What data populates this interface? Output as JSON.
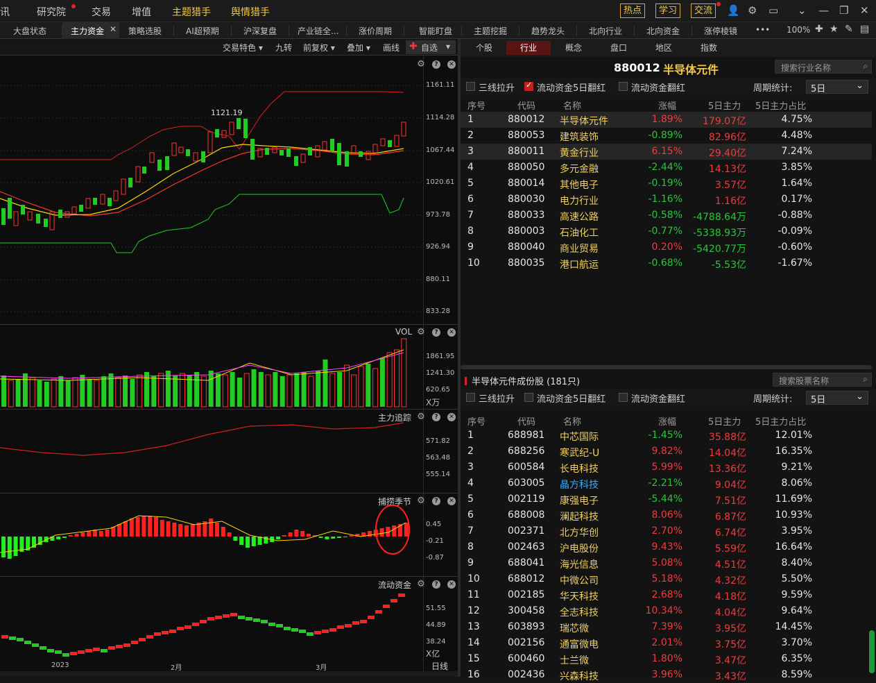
{
  "menu": {
    "items": [
      "讯",
      "研究院",
      "交易",
      "增值",
      "主题猎手",
      "舆情猎手"
    ],
    "right_buttons": [
      "热点",
      "学习",
      "交流"
    ],
    "zoom": "100%"
  },
  "tabs": [
    "大盘状态",
    "主力资金",
    "策略选股",
    "AI超预期",
    "沪深复盘",
    "产业链全...",
    "涨价周期",
    "智能盯盘",
    "主题挖掘",
    "趋势龙头",
    "北向行业",
    "北向资金",
    "涨停棱镜"
  ],
  "toolbar": [
    "交易特色",
    "九转",
    "前复权",
    "叠加",
    "画线",
    "自选"
  ],
  "chart": {
    "main_y": [
      "1161.11",
      "1114.28",
      "1067.44",
      "1020.61",
      "973.78",
      "926.94",
      "880.11",
      "833.28"
    ],
    "high_label": "1121.19",
    "vol_title": "VOL",
    "vol_y": [
      "1861.95",
      "1241.30",
      "620.65"
    ],
    "vol_unit": "X万",
    "p3_title": "主力追踪",
    "p3_y": [
      "571.82",
      "563.48",
      "555.14"
    ],
    "p4_title": "捕捞季节",
    "p4_y": [
      "0.45",
      "-0.21",
      "-0.87"
    ],
    "p5_title": "流动资金",
    "p5_y": [
      "51.55",
      "44.89",
      "38.24"
    ],
    "p5_unit": "X亿",
    "x_labels": [
      "2023",
      "2月",
      "3月"
    ],
    "period": "日线"
  },
  "right": {
    "tabs": [
      "个股",
      "行业",
      "概念",
      "盘口",
      "地区",
      "指数"
    ],
    "title_code": "880012",
    "title_name": "半导体元件",
    "search1": "搜索行业名称",
    "search2": "搜索股票名称",
    "checks": [
      "三线拉升",
      "流动资金5日翻红",
      "流动资金翻红"
    ],
    "period_label": "周期统计:",
    "period_value": "5日",
    "headers": [
      "序号",
      "代码",
      "名称",
      "涨幅",
      "5日主力",
      "5日主力占比"
    ],
    "industry_rows": [
      [
        "1",
        "880012",
        "半导体元件",
        "1.89%",
        "179.07亿",
        "4.75%"
      ],
      [
        "2",
        "880053",
        "建筑装饰",
        "-0.89%",
        "82.96亿",
        "4.48%"
      ],
      [
        "3",
        "880011",
        "黄金行业",
        "6.15%",
        "29.40亿",
        "7.24%"
      ],
      [
        "4",
        "880050",
        "多元金融",
        "-2.44%",
        "14.13亿",
        "3.85%"
      ],
      [
        "5",
        "880014",
        "其他电子",
        "-0.19%",
        "3.57亿",
        "1.64%"
      ],
      [
        "6",
        "880030",
        "电力行业",
        "-1.16%",
        "1.16亿",
        "0.17%"
      ],
      [
        "7",
        "880033",
        "高速公路",
        "-0.58%",
        "-4788.64万",
        "-0.88%"
      ],
      [
        "8",
        "880003",
        "石油化工",
        "-0.77%",
        "-5338.93万",
        "-0.09%"
      ],
      [
        "9",
        "880040",
        "商业贸易",
        "0.20%",
        "-5420.77万",
        "-0.60%"
      ],
      [
        "10",
        "880035",
        "港口航运",
        "-0.68%",
        "-5.53亿",
        "-1.67%"
      ]
    ],
    "constituents_title": "半导体元件成份股 (181只)",
    "stock_rows": [
      [
        "1",
        "688981",
        "中芯国际",
        "-1.45%",
        "35.88亿",
        "12.01%"
      ],
      [
        "2",
        "688256",
        "寒武纪-U",
        "9.82%",
        "14.04亿",
        "16.35%"
      ],
      [
        "3",
        "600584",
        "长电科技",
        "5.99%",
        "13.36亿",
        "9.21%"
      ],
      [
        "4",
        "603005",
        "晶方科技",
        "-2.21%",
        "9.04亿",
        "8.06%"
      ],
      [
        "5",
        "002119",
        "康强电子",
        "-5.44%",
        "7.51亿",
        "11.69%"
      ],
      [
        "6",
        "688008",
        "澜起科技",
        "8.06%",
        "6.87亿",
        "10.93%"
      ],
      [
        "7",
        "002371",
        "北方华创",
        "2.70%",
        "6.74亿",
        "3.95%"
      ],
      [
        "8",
        "002463",
        "沪电股份",
        "9.43%",
        "5.59亿",
        "16.64%"
      ],
      [
        "9",
        "688041",
        "海光信息",
        "5.08%",
        "4.51亿",
        "8.40%"
      ],
      [
        "10",
        "688012",
        "中微公司",
        "5.18%",
        "4.32亿",
        "5.50%"
      ],
      [
        "11",
        "002185",
        "华天科技",
        "2.68%",
        "4.18亿",
        "9.59%"
      ],
      [
        "12",
        "300458",
        "全志科技",
        "10.34%",
        "4.04亿",
        "9.64%"
      ],
      [
        "13",
        "603893",
        "瑞芯微",
        "7.39%",
        "3.95亿",
        "14.45%"
      ],
      [
        "14",
        "002156",
        "通富微电",
        "2.01%",
        "3.75亿",
        "3.70%"
      ],
      [
        "15",
        "600460",
        "士兰微",
        "1.80%",
        "3.47亿",
        "6.35%"
      ],
      [
        "16",
        "002436",
        "兴森科技",
        "3.96%",
        "3.43亿",
        "8.59%"
      ]
    ]
  }
}
